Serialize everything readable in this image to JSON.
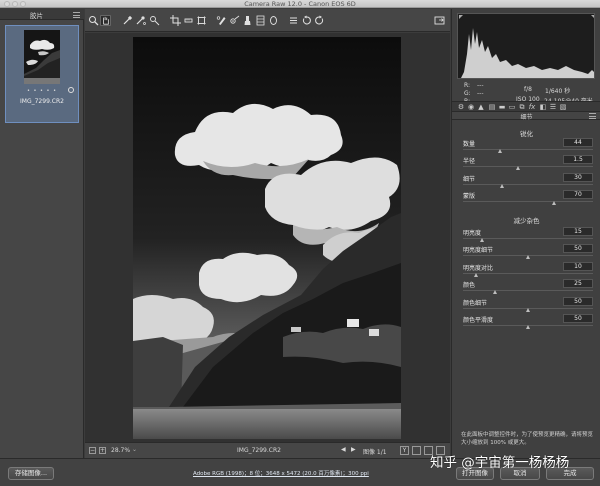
{
  "window": {
    "title": "Camera Raw 12.0 - Canon EOS 6D"
  },
  "filmstrip": {
    "title": "胶片",
    "thumbnail": {
      "filename": "IMG_7299.CR2",
      "rating_dots": "• • • • •"
    }
  },
  "toolbar": {
    "tools": [
      "zoom-icon",
      "hand-icon",
      "white-balance-icon",
      "color-sampler-icon",
      "target-adjust-icon",
      "crop-icon",
      "straighten-icon",
      "transform-icon",
      "spot-removal-icon",
      "red-eye-icon",
      "adjustment-brush-icon",
      "graduated-filter-icon",
      "radial-filter-icon",
      "preferences-icon",
      "rotate-ccw-icon",
      "rotate-cw-icon"
    ],
    "active_tool": "hand-icon"
  },
  "histogram": {
    "r_label": "R:",
    "g_label": "G:",
    "b_label": "B:",
    "r_value": "---",
    "g_value": "---",
    "b_value": "---",
    "aperture": "f/8",
    "shutter": "1/640 秒",
    "iso": "ISO 100",
    "lens": "24-105@40 毫米"
  },
  "panel": {
    "title": "细节",
    "sharpening": {
      "heading": "锐化",
      "sliders": [
        {
          "label": "数量",
          "value": "44",
          "fraction": 0.29
        },
        {
          "label": "半径",
          "value": "1.5",
          "fraction": 0.43
        },
        {
          "label": "细节",
          "value": "30",
          "fraction": 0.3
        },
        {
          "label": "蒙版",
          "value": "70",
          "fraction": 0.7
        }
      ]
    },
    "noise": {
      "heading": "减少杂色",
      "sliders": [
        {
          "label": "明亮度",
          "value": "15",
          "fraction": 0.15
        },
        {
          "label": "明亮度细节",
          "value": "50",
          "fraction": 0.5
        },
        {
          "label": "明亮度对比",
          "value": "10",
          "fraction": 0.1
        },
        {
          "label": "颜色",
          "value": "25",
          "fraction": 0.25
        },
        {
          "label": "颜色细节",
          "value": "50",
          "fraction": 0.5
        },
        {
          "label": "颜色平滑度",
          "value": "50",
          "fraction": 0.5
        }
      ]
    },
    "hint": "在此面板中调整控件时，为了使预览更精确，请将预览大小缩放到 100% 或更大。"
  },
  "zoombar": {
    "minus": "−",
    "plus": "+",
    "zoom": "28.7%",
    "filename": "IMG_7299.CR2",
    "image_counter": "图像 1/1"
  },
  "bottom": {
    "save_label": "存储图像...",
    "workflow_link": "Adobe RGB (1998)；8 位；3648 x 5472 (20.0 百万像素)；300 ppi",
    "open_label": "打开图像",
    "cancel_label": "取消",
    "done_label": "完成"
  },
  "watermark": "知乎 @宇宙第一杨杨杨",
  "colors": {
    "accent": "#6f8fbf",
    "panel_bg": "#404040",
    "canvas_bg": "#313131"
  }
}
